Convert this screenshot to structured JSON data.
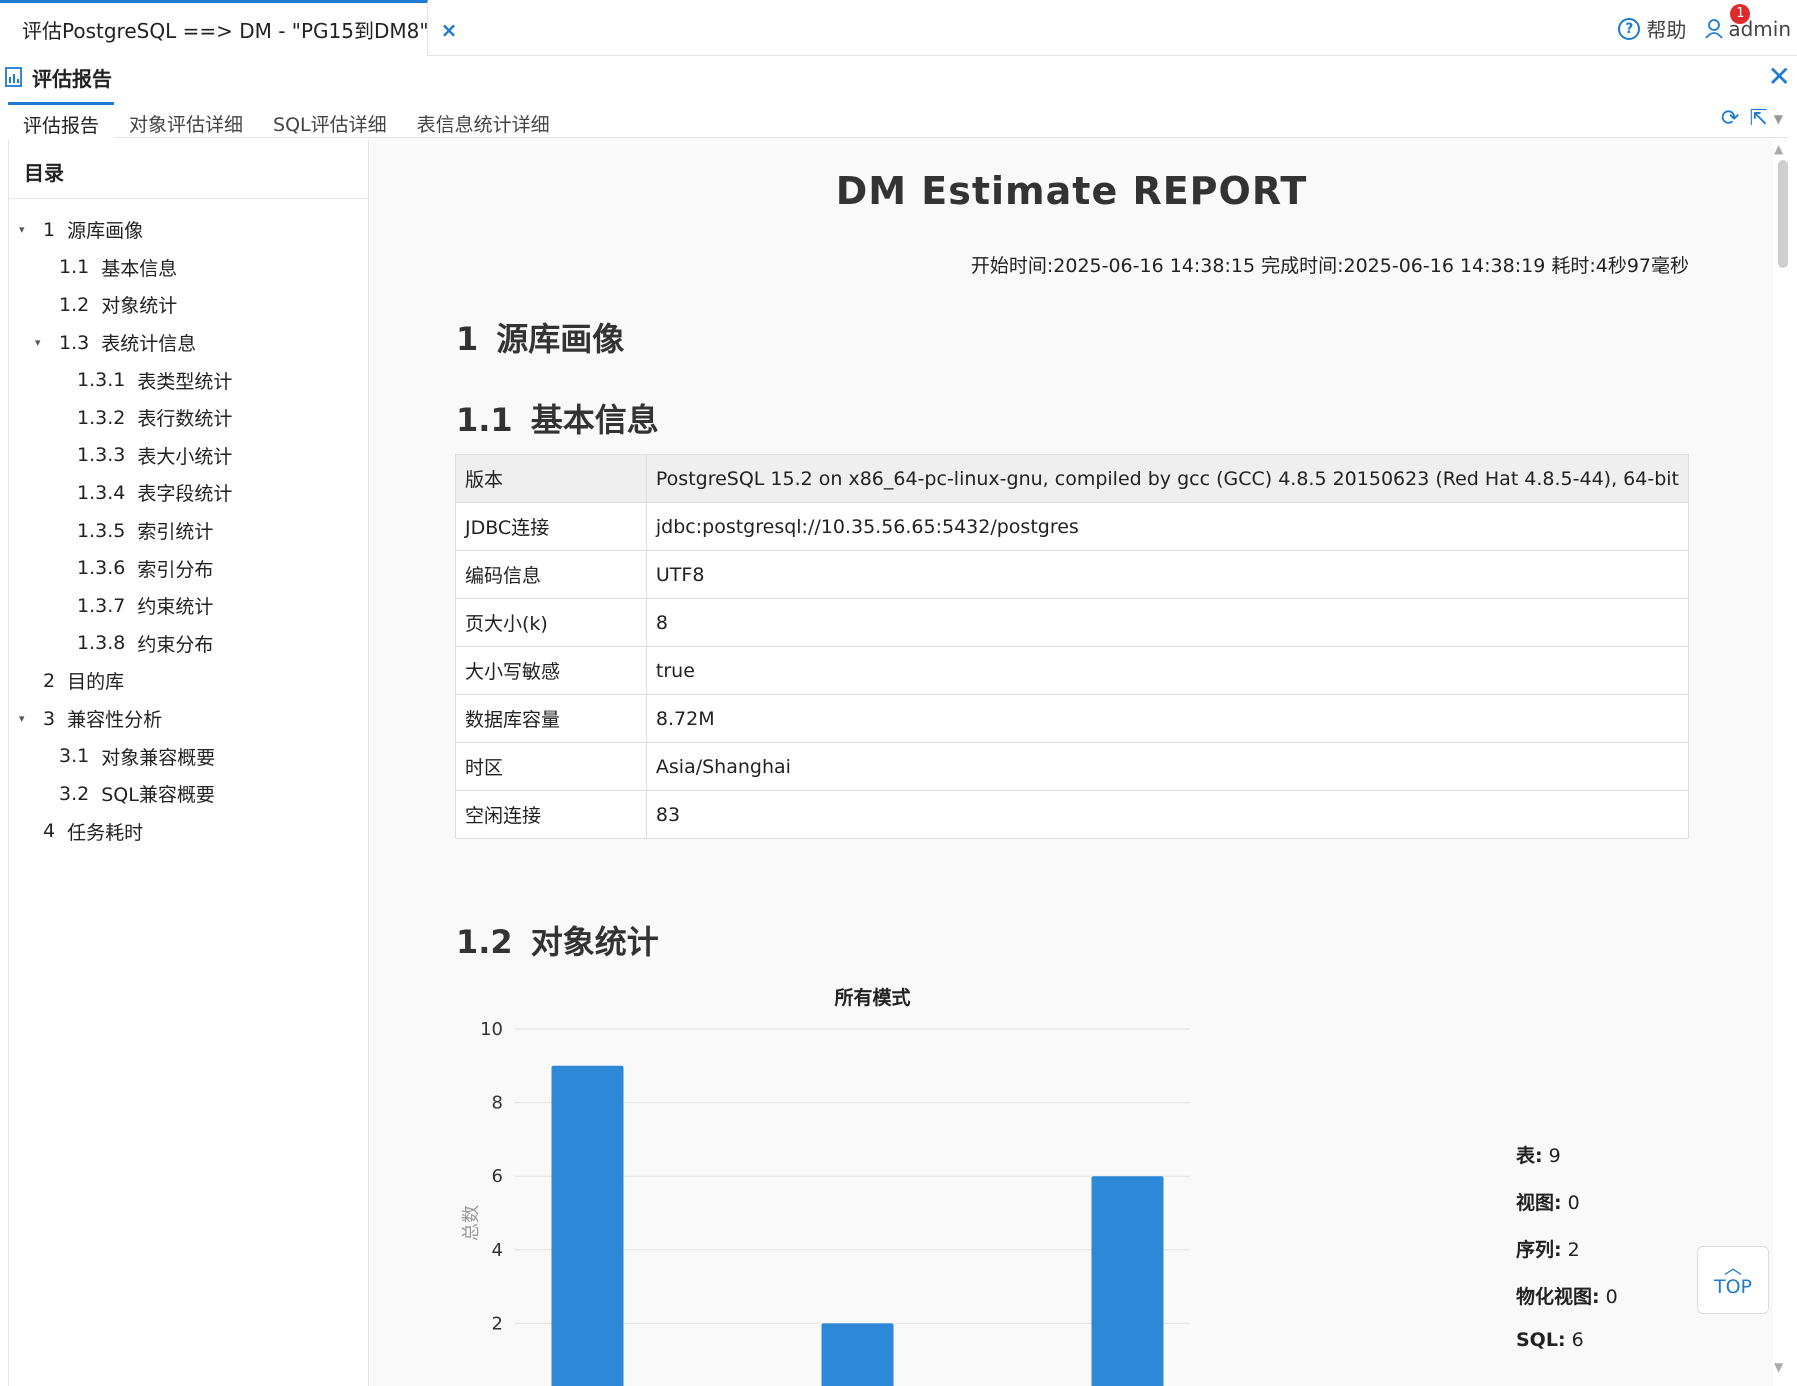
{
  "top_tab": {
    "title": "评估PostgreSQL ==> DM - \"PG15到DM8\"",
    "close": "×"
  },
  "header_right": {
    "help": "帮助",
    "user": "admin",
    "notification_count": "1"
  },
  "subheader": {
    "title": "评估报告",
    "close": "✕"
  },
  "report_tabs": [
    {
      "label": "评估报告",
      "active": true
    },
    {
      "label": "对象评估详细"
    },
    {
      "label": "SQL评估详细"
    },
    {
      "label": "表信息统计详细"
    }
  ],
  "toolbar": {
    "refresh_icon": "refresh-icon",
    "export_icon": "export-icon"
  },
  "toc": {
    "title": "目录",
    "items": [
      {
        "arrow": "▾",
        "num": "1",
        "label": "源库画像"
      },
      {
        "num": "1.1",
        "label": "基本信息"
      },
      {
        "num": "1.2",
        "label": "对象统计"
      },
      {
        "arrow": "▾",
        "num": "1.3",
        "label": "表统计信息"
      },
      {
        "num": "1.3.1",
        "label": "表类型统计"
      },
      {
        "num": "1.3.2",
        "label": "表行数统计"
      },
      {
        "num": "1.3.3",
        "label": "表大小统计"
      },
      {
        "num": "1.3.4",
        "label": "表字段统计"
      },
      {
        "num": "1.3.5",
        "label": "索引统计"
      },
      {
        "num": "1.3.6",
        "label": "索引分布"
      },
      {
        "num": "1.3.7",
        "label": "约束统计"
      },
      {
        "num": "1.3.8",
        "label": "约束分布"
      },
      {
        "num": "2",
        "label": "目的库"
      },
      {
        "arrow": "▾",
        "num": "3",
        "label": "兼容性分析"
      },
      {
        "num": "3.1",
        "label": "对象兼容概要"
      },
      {
        "num": "3.2",
        "label": "SQL兼容概要"
      },
      {
        "num": "4",
        "label": "任务耗时"
      }
    ]
  },
  "report": {
    "title": "DM Estimate REPORT",
    "timing": "开始时间:2025-06-16 14:38:15 完成时间:2025-06-16 14:38:19 耗时:4秒97毫秒",
    "section1": {
      "num": "1",
      "title": "源库画像"
    },
    "section1_1": {
      "num": "1.1",
      "title": "基本信息"
    },
    "basic_info": [
      {
        "k": "版本",
        "v": "PostgreSQL 15.2 on x86_64-pc-linux-gnu, compiled by gcc (GCC) 4.8.5 20150623 (Red Hat 4.8.5-44), 64-bit"
      },
      {
        "k": "JDBC连接",
        "v": "jdbc:postgresql://10.35.56.65:5432/postgres"
      },
      {
        "k": "编码信息",
        "v": "UTF8"
      },
      {
        "k": "页大小(k)",
        "v": "8"
      },
      {
        "k": "大小写敏感",
        "v": "true"
      },
      {
        "k": "数据库容量",
        "v": "8.72M"
      },
      {
        "k": "时区",
        "v": "Asia/Shanghai"
      },
      {
        "k": "空闲连接",
        "v": "83"
      }
    ],
    "section1_2": {
      "num": "1.2",
      "title": "对象统计"
    },
    "legend": [
      {
        "k": "表:",
        "v": "9"
      },
      {
        "k": "视图:",
        "v": "0"
      },
      {
        "k": "序列:",
        "v": "2"
      },
      {
        "k": "物化视图:",
        "v": "0"
      },
      {
        "k": "SQL:",
        "v": "6"
      }
    ]
  },
  "chart_data": {
    "type": "bar",
    "title": "所有模式",
    "ylabel": "总数",
    "xlabel": "",
    "categories": [
      "表",
      "视图",
      "序列",
      "物化视图",
      "SQL"
    ],
    "values": [
      9,
      0,
      2,
      0,
      6
    ],
    "ylim": [
      0,
      10
    ],
    "yticks": [
      0,
      2,
      4,
      6,
      8,
      10
    ],
    "grid": true,
    "bar_color": "#2e88d8"
  },
  "top_button": {
    "label": "TOP",
    "chevron": "︿"
  },
  "colors": {
    "accent": "#1f7ad1",
    "badge": "#e02a2a"
  }
}
